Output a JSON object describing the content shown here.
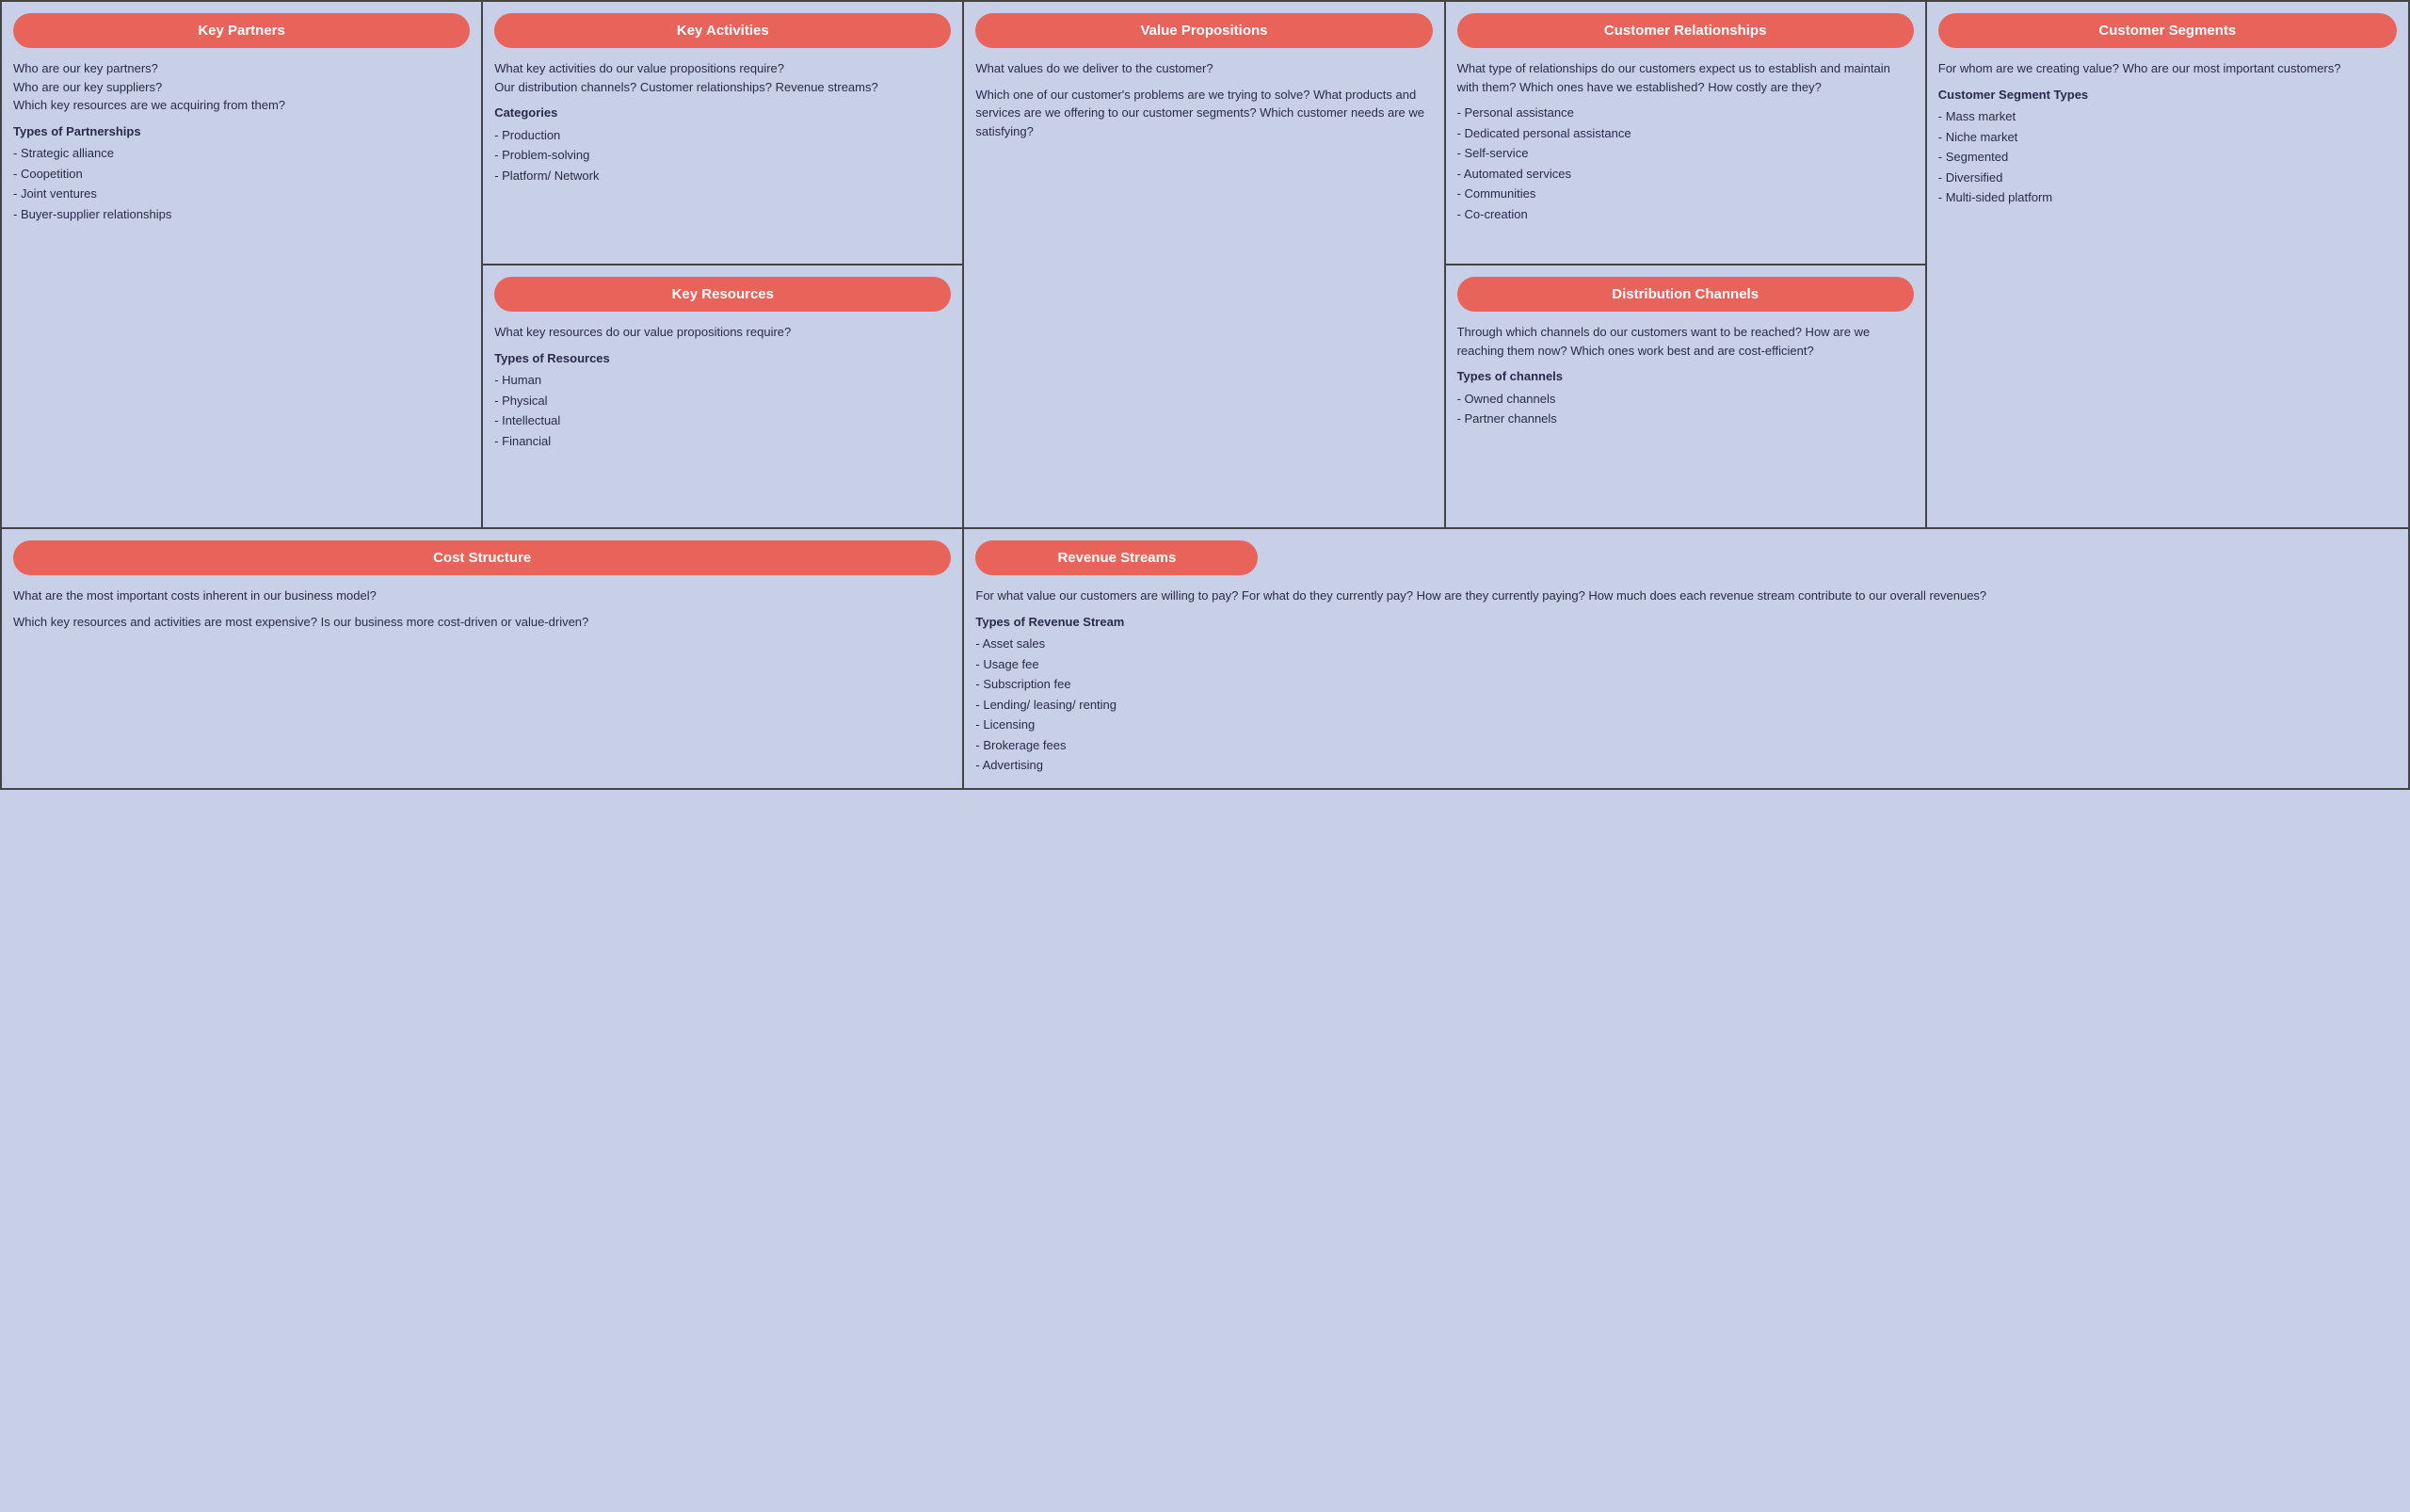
{
  "keyPartners": {
    "title": "Key Partners",
    "lines": [
      "Who are our key partners?",
      "Who are our key suppliers?",
      "Which key resources are we acquiring from them?",
      "",
      "Types of Partnerships",
      "- Strategic alliance",
      "- Coopetition",
      "- Joint ventures",
      "- Buyer-supplier relationships"
    ]
  },
  "keyActivities": {
    "title": "Key Activities",
    "lines": [
      "What key activities do our value propositions require?",
      "Our distribution channels?  Customer relationships? Revenue streams?",
      "",
      "Categories",
      "- Production",
      "- Problem-solving",
      "- Platform/ Network"
    ]
  },
  "keyResources": {
    "title": "Key Resources",
    "lines": [
      "What key resources do our value propositions require?",
      "",
      "Types of Resources",
      "- Human",
      "- Physical",
      "- Intellectual",
      "- Financial"
    ]
  },
  "valuePropositions": {
    "title": "Value Propositions",
    "lines": [
      "What values do we deliver to the customer?",
      "",
      "Which one of our customer's problems are we trying to solve? What products and services are we offering to our customer segments? Which customer needs are we satisfying?"
    ]
  },
  "customerRelationships": {
    "title": "Customer Relationships",
    "lines": [
      "What type of relationships do our customers expect us to establish and maintain with them? Which ones have we established? How costly are they?",
      "- Personal assistance",
      "- Dedicated personal assistance",
      "- Self-service",
      "- Automated services",
      "- Communities",
      "- Co-creation"
    ]
  },
  "distributionChannels": {
    "title": "Distribution Channels",
    "lines": [
      "Through which channels do our customers want to be reached? How are we reaching them now? Which ones work best and are cost-efficient?",
      "",
      "Types of channels",
      "- Owned channels",
      "- Partner channels"
    ]
  },
  "customerSegments": {
    "title": "Customer Segments",
    "lines": [
      "For whom are we creating value? Who are our most important customers?",
      "",
      "Customer Segment Types",
      "- Mass market",
      "- Niche market",
      "- Segmented",
      "- Diversified",
      "- Multi-sided platform"
    ]
  },
  "costStructure": {
    "title": "Cost Structure",
    "lines": [
      "What are the most important costs inherent in our business model?",
      "",
      "Which key resources and activities are most expensive? Is our business more cost-driven or value-driven?"
    ]
  },
  "revenueStreams": {
    "title": "Revenue Streams",
    "lines": [
      "For what value our customers are willing to pay? For what do they currently pay? How are they currently paying? How much does each revenue stream contribute to our overall revenues?",
      "",
      "Types of Revenue Stream",
      "- Asset sales",
      "- Usage fee",
      "- Subscription fee",
      "- Lending/ leasing/ renting",
      "- Licensing",
      "- Brokerage fees",
      "- Advertising"
    ]
  }
}
